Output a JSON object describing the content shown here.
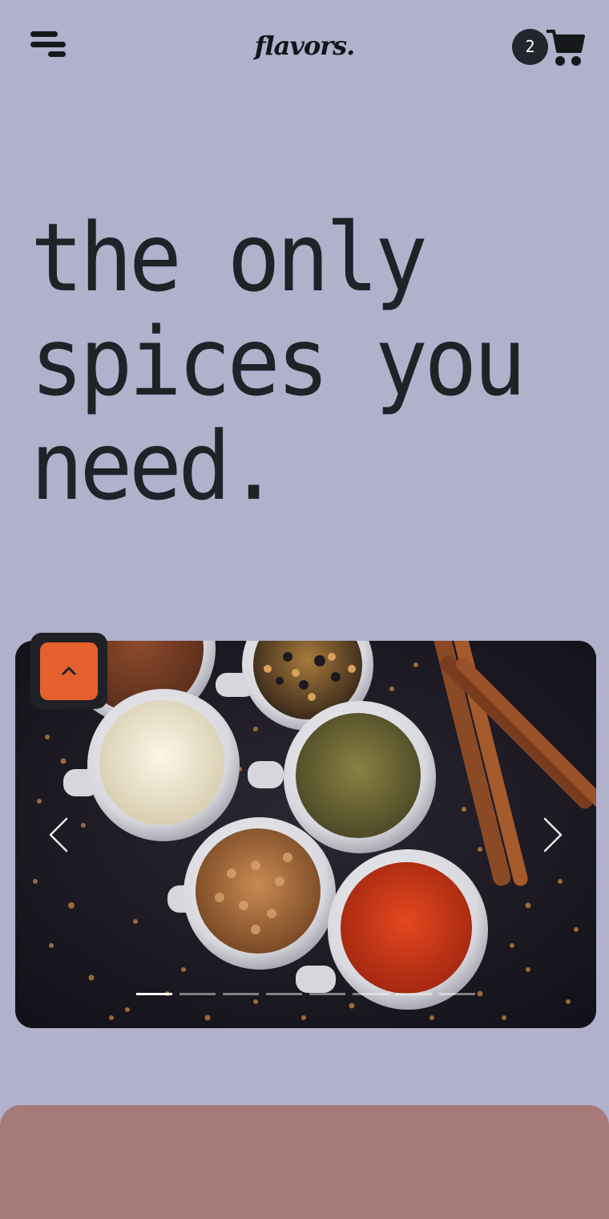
{
  "header": {
    "logo_text": "flavors.",
    "cart_count": "2",
    "menu_icon": "hamburger-icon",
    "cart_icon": "cart-icon"
  },
  "hero": {
    "line1": "the only",
    "line2": "spices you",
    "line3": "need."
  },
  "carousel": {
    "slide_count": 8,
    "active_index": 0,
    "prev_icon": "chevron-left-icon",
    "next_icon": "chevron-right-icon"
  },
  "scroll_top": {
    "icon": "chevron-up-icon"
  },
  "colors": {
    "background": "#b1b1cc",
    "text": "#1f2328",
    "accent": "#e4602c",
    "panel": "#a57a79"
  }
}
